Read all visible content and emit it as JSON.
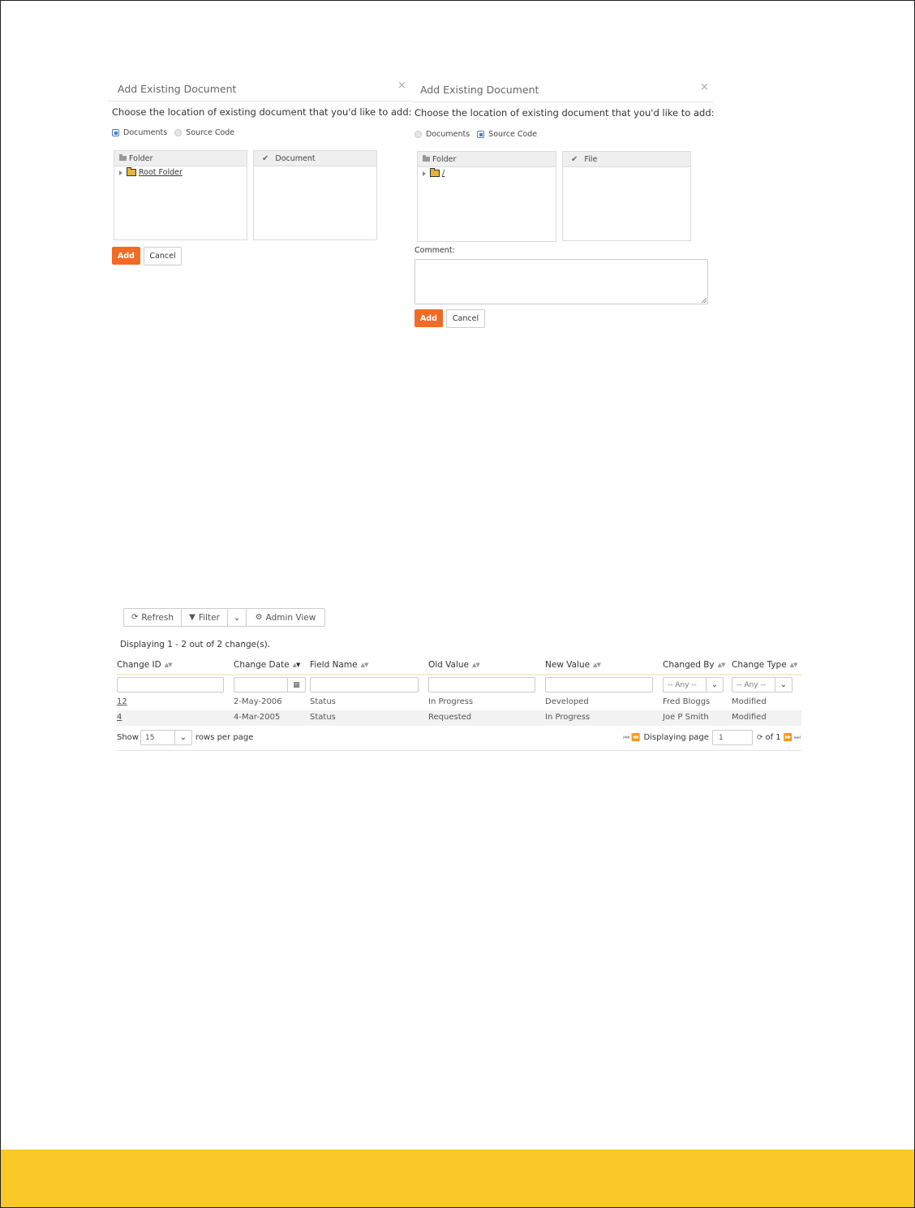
{
  "dialog_left": {
    "title": "Add Existing Document",
    "close": "×",
    "prompt": "Choose the location of existing document that you'd like to add:",
    "radio_documents": "Documents",
    "radio_source_code": "Source Code",
    "selected": "Documents",
    "folder_header": "Folder",
    "right_header": "Document",
    "tree_item": "Root Folder",
    "add_label": "Add",
    "cancel_label": "Cancel"
  },
  "dialog_right": {
    "title": "Add Existing Document",
    "close": "×",
    "prompt": "Choose the location of existing document that you'd like to add:",
    "radio_documents": "Documents",
    "radio_source_code": "Source Code",
    "selected": "Source Code",
    "folder_header": "Folder",
    "right_header": "File",
    "tree_item": "/",
    "comment_label": "Comment:",
    "comment_value": "",
    "add_label": "Add",
    "cancel_label": "Cancel"
  },
  "grid": {
    "toolbar": {
      "refresh": "Refresh",
      "filter": "Filter",
      "admin_view": "Admin View"
    },
    "displaying": "Displaying 1 - 2 out of 2 change(s).",
    "columns": [
      "Change ID",
      "Change Date",
      "Field Name",
      "Old Value",
      "New Value",
      "Changed By",
      "Change Type"
    ],
    "filters": {
      "changed_by": "-- Any --",
      "change_type": "-- Any --"
    },
    "rows": [
      {
        "id": "12",
        "date": "2-May-2006",
        "field": "Status",
        "old": "In Progress",
        "new": "Developed",
        "by": "Fred Bloggs",
        "type": "Modified"
      },
      {
        "id": "4",
        "date": "4-Mar-2005",
        "field": "Status",
        "old": "Requested",
        "new": "In Progress",
        "by": "Joe P Smith",
        "type": "Modified"
      }
    ],
    "footer": {
      "show": "Show",
      "rows_per_page_value": "15",
      "rows_per_page": "rows per page",
      "displaying_page": "Displaying page",
      "page_value": "1",
      "of": "of 1"
    }
  },
  "colors": {
    "accent_orange": "#f26a24",
    "footer_yellow": "#fbc927"
  }
}
